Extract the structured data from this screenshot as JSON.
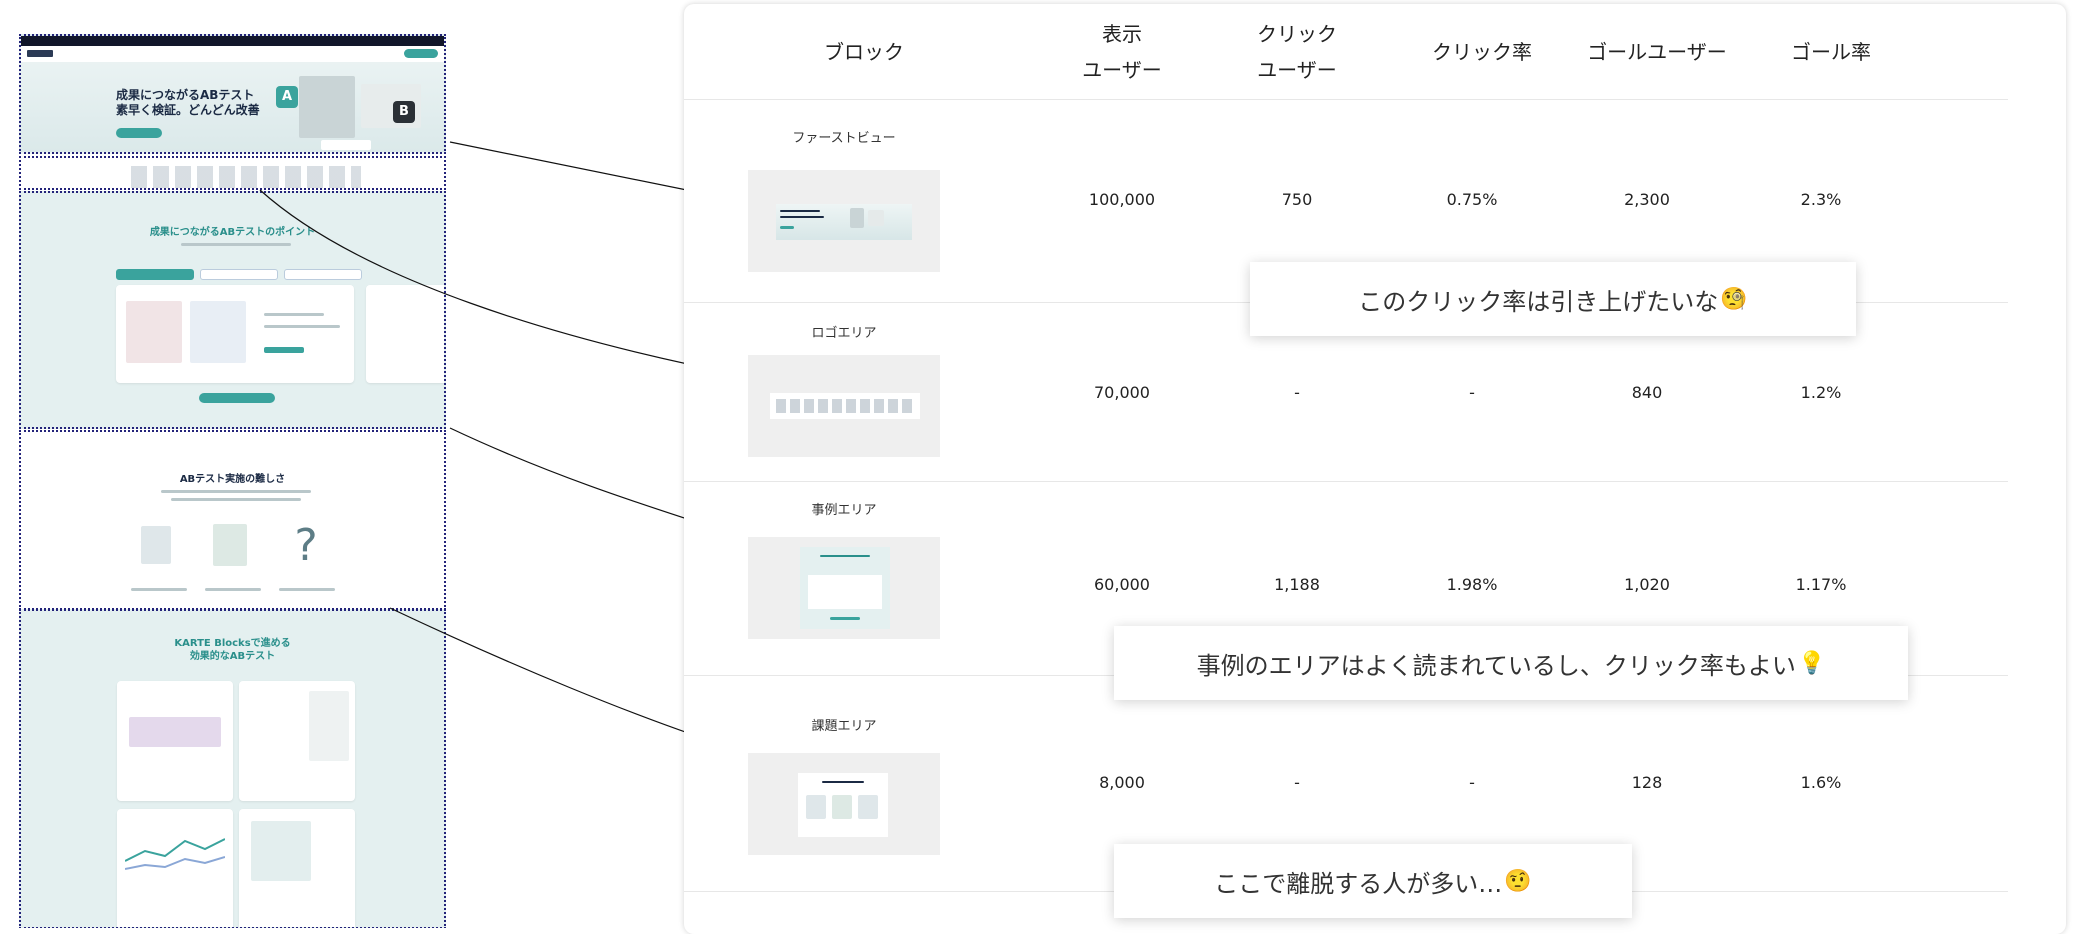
{
  "table": {
    "headers": {
      "block": "ブロック",
      "view_users": "表示\nユーザー",
      "click_users": "クリック\nユーザー",
      "click_rate": "クリック率",
      "goal_users": "ゴールユーザー",
      "goal_rate": "ゴール率"
    },
    "rows": [
      {
        "name": "ファーストビュー",
        "view_users": "100,000",
        "click_users": "750",
        "click_rate": "0.75%",
        "goal_users": "2,300",
        "goal_rate": "2.3%"
      },
      {
        "name": "ロゴエリア",
        "view_users": "70,000",
        "click_users": "-",
        "click_rate": "-",
        "goal_users": "840",
        "goal_rate": "1.2%"
      },
      {
        "name": "事例エリア",
        "view_users": "60,000",
        "click_users": "1,188",
        "click_rate": "1.98%",
        "goal_users": "1,020",
        "goal_rate": "1.17%"
      },
      {
        "name": "課題エリア",
        "view_users": "8,000",
        "click_users": "-",
        "click_rate": "-",
        "goal_users": "128",
        "goal_rate": "1.6%"
      }
    ]
  },
  "bubbles": [
    {
      "text": "このクリック率は引き上げたいな",
      "emoji": "🧐"
    },
    {
      "text": "事例のエリアはよく読まれているし、クリック率もよい",
      "emoji": "💡"
    },
    {
      "text": "ここで離脱する人が多い…",
      "emoji": "🤨"
    }
  ],
  "page_mock": {
    "fv_title": "成果につながるABテスト\n素早く検証。どんどん改善",
    "badge_a": "A",
    "badge_b": "B",
    "case_heading": "成果につながるABテストのポイント",
    "problem_heading": "ABテスト実施の難しさ",
    "kb_heading": "KARTE Blocksで進める\n効果的なABテスト"
  },
  "colors": {
    "accent": "#3aa39d",
    "outline": "#23237a",
    "section_bg": "#e4f0f0"
  }
}
